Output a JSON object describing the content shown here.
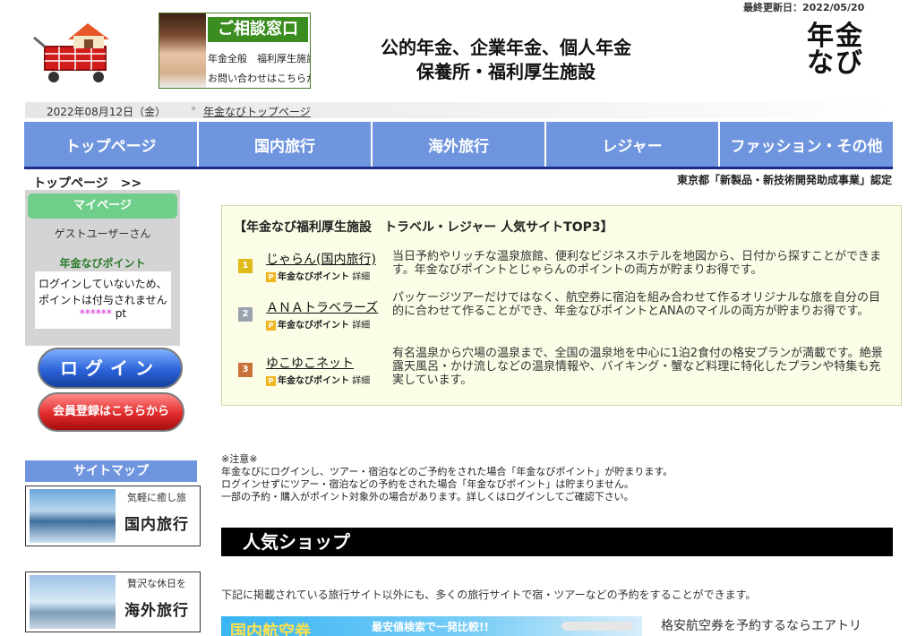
{
  "header": {
    "updated": "最終更新日：2022/05/20",
    "consult_title": "ご相談窓口",
    "consult_line1": "年金全般　福利厚生施設",
    "consult_line2": "お問い合わせはこちらから",
    "headline_line1": "公的年金、企業年金、個人年金",
    "headline_line2": "保養所・福利厚生施設",
    "logo_line1": "年金",
    "logo_line2": "なび"
  },
  "datebar": {
    "date": "2022年08月12日（金）",
    "toplink": "年金なびトップページ"
  },
  "nav": {
    "items": [
      "トップページ",
      "国内旅行",
      "海外旅行",
      "レジャー",
      "ファッション・その他"
    ]
  },
  "breadcrumb": "トップページ　>>",
  "certified": "東京都「新製品・新技術開発助成事業」認定",
  "mypage": {
    "title": "マイページ",
    "guest": "ゲストユーザーさん",
    "point_title": "年金なびポイント",
    "point_line1": "ログインしていないため、",
    "point_line2": "ポイントは付与されません",
    "point_stars": "******",
    "point_unit": " pt"
  },
  "buttons": {
    "login": "ログイン",
    "register": "会員登録はこちらから"
  },
  "sitemap": {
    "title": "サイトマップ",
    "cards": [
      {
        "caption": "気軽に癒し旅",
        "label": "国内旅行"
      },
      {
        "caption": "贅沢な休日を",
        "label": "海外旅行"
      }
    ]
  },
  "top3": {
    "title": "【年金なび福利厚生施設　トラベル・レジャー 人気サイトTOP3】",
    "badge_p": "P",
    "badge_label": "年金なびポイント",
    "badge_detail": "詳細",
    "items": [
      {
        "rank": "1",
        "name": "じゃらん(国内旅行)",
        "desc": "当日予約やリッチな温泉旅館、便利なビジネスホテルを地図から、日付から探すことができます。年金なびポイントとじゃらんのポイントの両方が貯まりお得です。"
      },
      {
        "rank": "2",
        "name": "ＡＮＡトラベラーズ",
        "desc": "パッケージツアーだけではなく、航空券に宿泊を組み合わせて作るオリジナルな旅を自分の目的に合わせて作ることができ、年金なびポイントとANAのマイルの両方が貯まりお得です。"
      },
      {
        "rank": "3",
        "name": "ゆこゆこネット",
        "desc": "有名温泉から穴場の温泉まで、全国の温泉地を中心に1泊2食付の格安プランが満載です。絶景露天風呂・かけ流しなどの温泉情報や、バイキング・蟹など料理に特化したプランや特集も充実しています。"
      }
    ]
  },
  "notes": {
    "head": "※注意※",
    "lines": [
      "年金なびにログインし、ツアー・宿泊などのご予約をされた場合「年金なびポイント」が貯まります。",
      "ログインせずにツアー・宿泊などの予約をされた場合「年金なびポイント」は貯まりません。",
      "一部の予約・購入がポイント対象外の場合があります。詳しくはログインしてご確認下さい。"
    ]
  },
  "popular": {
    "title": "人気ショップ",
    "intro": "下記に掲載されている旅行サイト以外にも、多くの旅行サイトで宿・ツアーなどの予約をすることができます。",
    "banner_title": "国内航空券",
    "banner_sub": "最安値検索で一発比較!!",
    "air_text": "格安航空券を予約するならエアトリ"
  },
  "colors": {
    "nav": "#6f95de",
    "nav_underline": "#1b2b8a",
    "mypage_head": "#6fcf8a",
    "top3_bg": "#fbfde6",
    "login": "#2c63d9",
    "register": "#e22b2b",
    "point_stars": "#d21edb"
  },
  "icons": {
    "cart": "shopping-cart-house-icon",
    "medal": "rank-medal-icon"
  }
}
